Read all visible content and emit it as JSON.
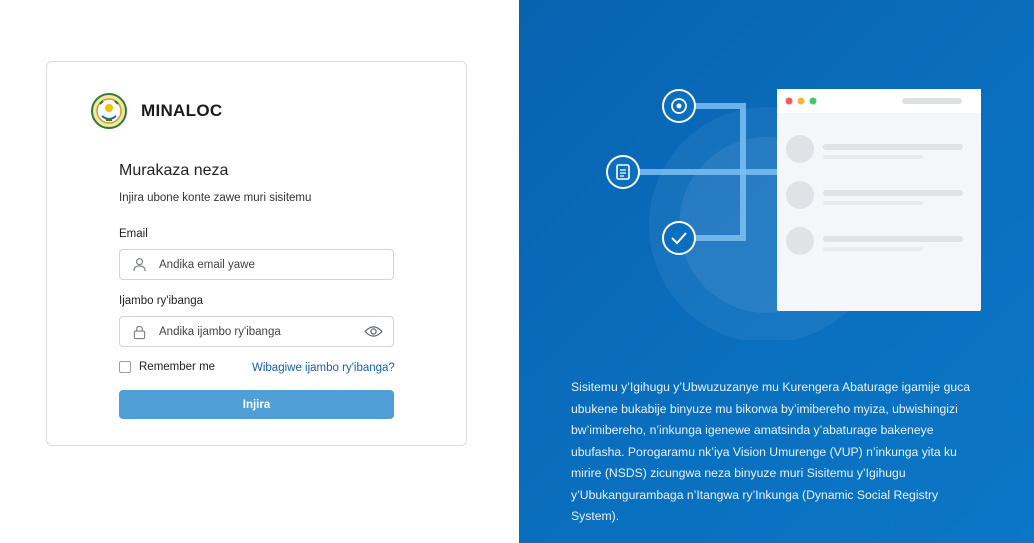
{
  "brand": {
    "name": "MINALOC"
  },
  "login": {
    "title": "Murakaza neza",
    "subtitle": "Injira ubone konte zawe muri sisitemu",
    "email_label": "Email",
    "email_placeholder": "Andika email yawe",
    "password_label": "Ijambo ry'ibanga",
    "password_placeholder": "Andika ijambo ry'ibanga",
    "remember_label": "Remember me",
    "forgot_label": "Wibagiwe ijambo ry'ibanga?",
    "submit_label": "Injira"
  },
  "info": {
    "description": "Sisitemu y’Igihugu y’Ubwuzuzanye mu Kurengera Abaturage igamije guca ubukene bukabije binyuze mu bikorwa by’imibereho myiza, ubwishingizi bw’imibereho, n’inkunga igenewe amatsinda y’abaturage bakeneye ubufasha. Porogaramu nk’iya Vision Umurenge (VUP) n’inkunga yita ku mirire (NSDS) zicungwa neza binyuze muri Sisitemu y’Igihugu y’Ubukangurambaga n’Itangwa ry’Inkunga (Dynamic Social Registry System)."
  },
  "colors": {
    "primary_button": "#4f9fd6",
    "link": "#1a5fb4",
    "panel_blue": "#0a6fbf"
  },
  "icons": [
    "rwanda-coat-of-arms-logo",
    "user-icon",
    "lock-icon",
    "eye-icon",
    "target-icon",
    "document-icon",
    "check-icon"
  ]
}
